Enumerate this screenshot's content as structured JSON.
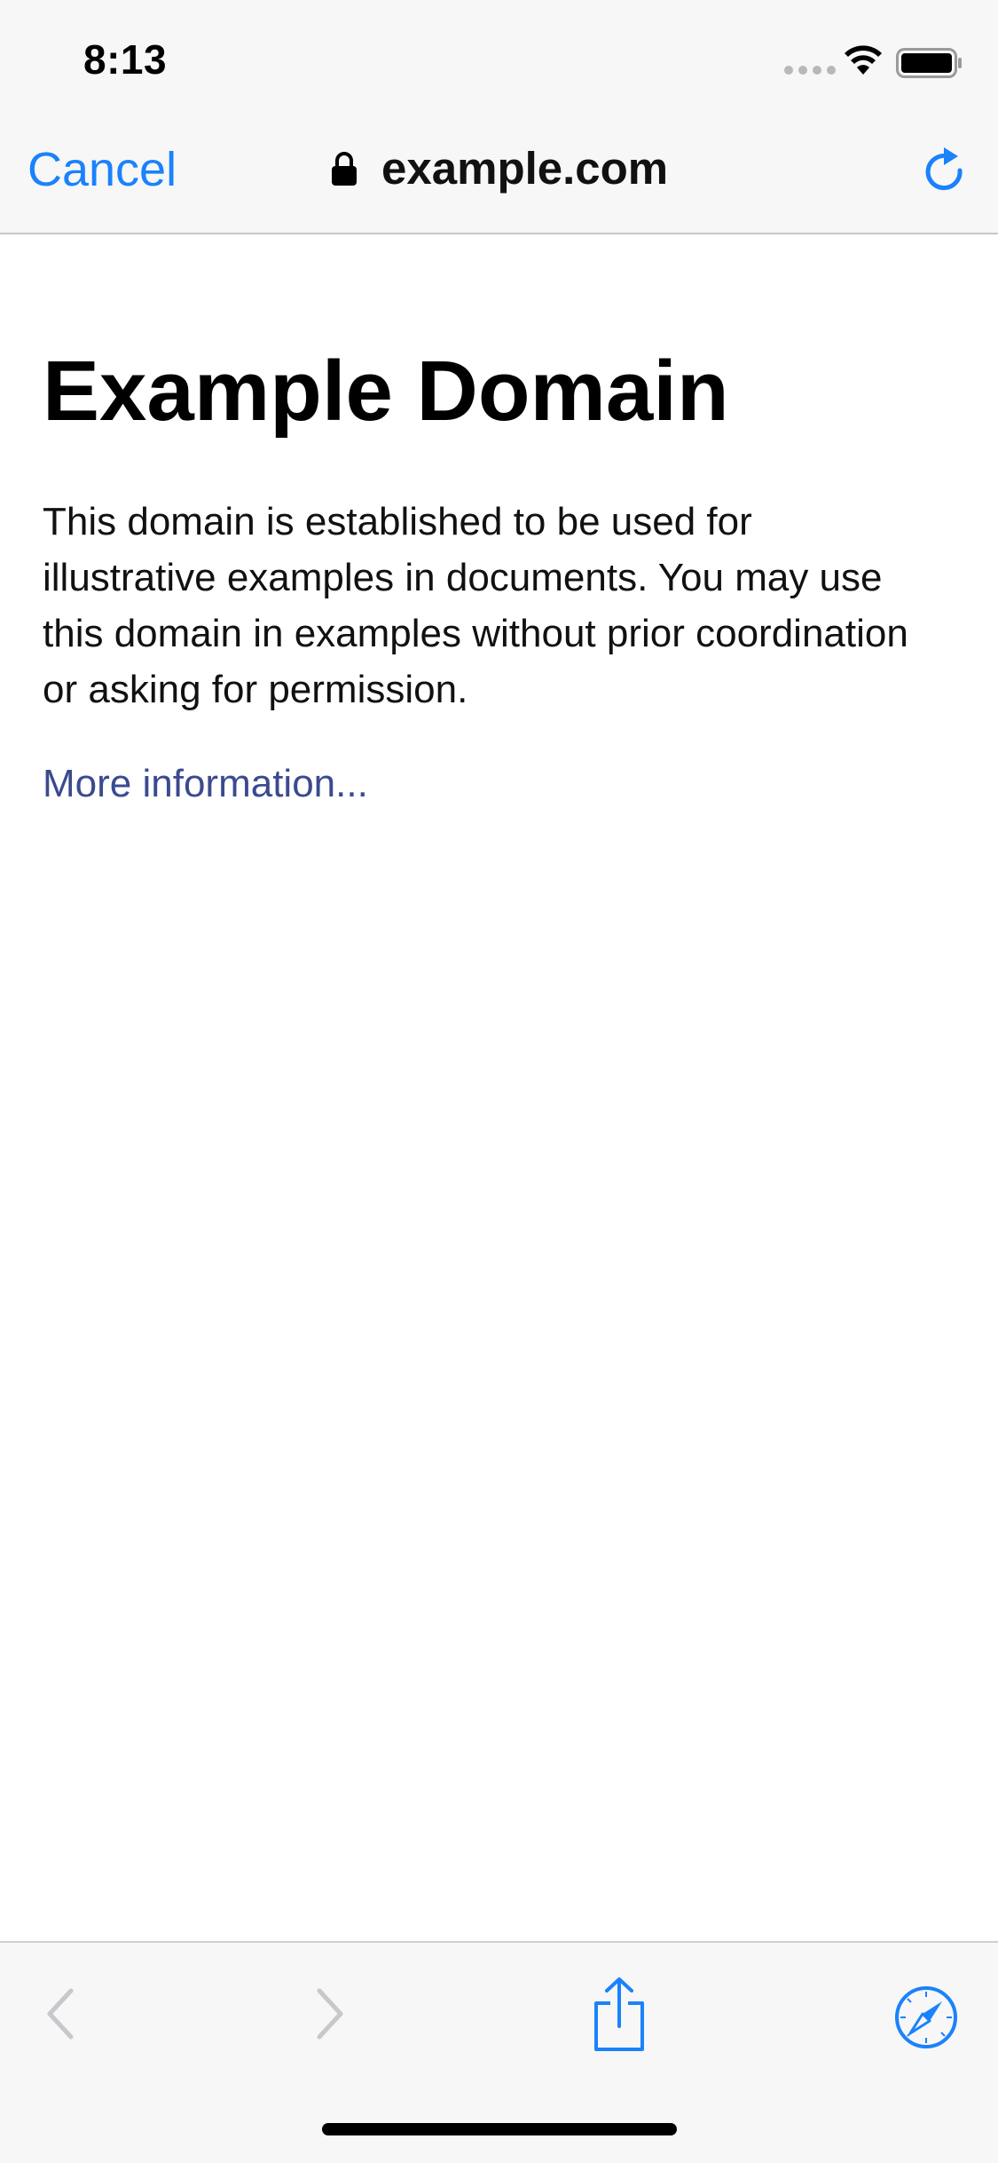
{
  "status_bar": {
    "time": "8:13",
    "icons": [
      "cellular-signal-icon",
      "wifi-icon",
      "battery-icon"
    ]
  },
  "nav_bar": {
    "cancel_label": "Cancel",
    "lock_icon": "lock-icon",
    "domain": "example.com",
    "reload_icon": "reload-icon"
  },
  "page": {
    "heading": "Example Domain",
    "paragraph": "This domain is established to be used for illustrative examples in documents. You may use this domain in examples without prior coordination or asking for permission.",
    "link": "More information..."
  },
  "toolbar": {
    "items": [
      {
        "icon": "back-chevron-icon",
        "enabled": false
      },
      {
        "icon": "forward-chevron-icon",
        "enabled": false
      },
      {
        "icon": "share-icon",
        "enabled": true
      },
      {
        "icon": "safari-compass-icon",
        "enabled": true
      }
    ]
  },
  "colors": {
    "accent": "#1a82fb",
    "link": "#3b4a8f",
    "bar_background": "#f7f7f7",
    "disabled": "#c7c7cc"
  }
}
